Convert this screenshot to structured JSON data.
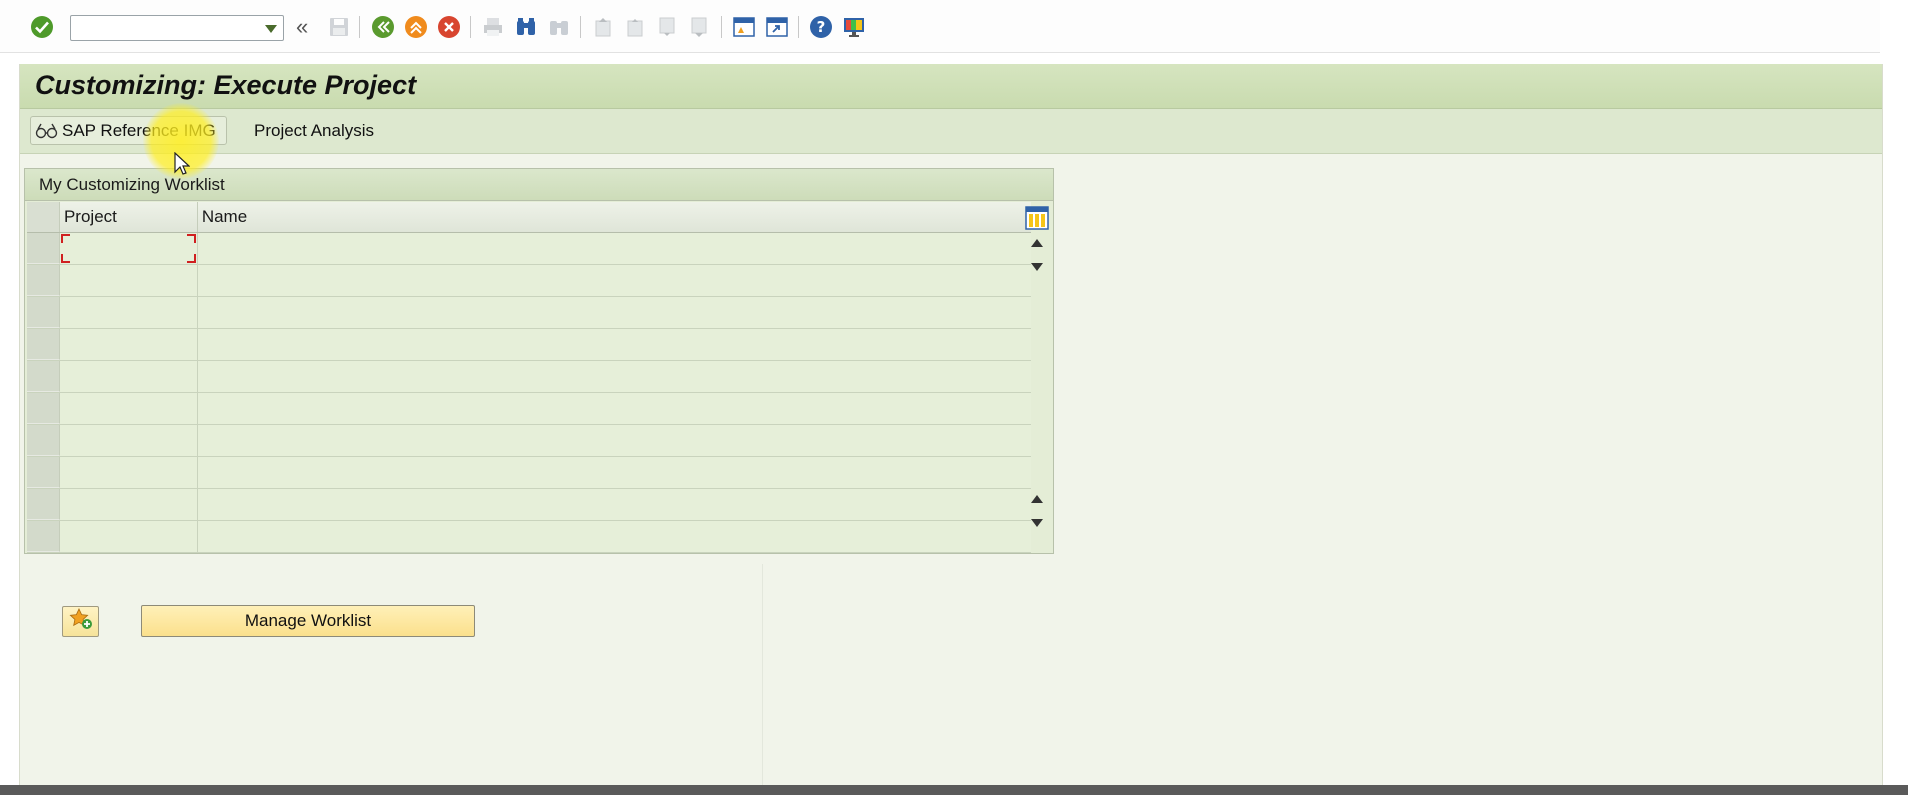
{
  "toolbar": {
    "command_field_value": "",
    "icons": [
      "enter-check-icon",
      "back-icon",
      "exit-icon",
      "cancel-icon",
      "save-icon",
      "print-icon",
      "find-icon",
      "find-next-icon",
      "first-page-icon",
      "previous-page-icon",
      "next-page-icon",
      "last-page-icon",
      "new-session-icon",
      "shortcut-icon",
      "help-icon",
      "customize-layout-icon"
    ]
  },
  "page": {
    "title": "Customizing: Execute Project"
  },
  "app_toolbar": {
    "sap_reference_img": "SAP Reference IMG",
    "project_analysis": "Project Analysis"
  },
  "worklist": {
    "heading": "My Customizing Worklist",
    "columns": [
      "Project",
      "Name"
    ],
    "rows": [
      {
        "project": "",
        "name": ""
      },
      {
        "project": "",
        "name": ""
      },
      {
        "project": "",
        "name": ""
      },
      {
        "project": "",
        "name": ""
      },
      {
        "project": "",
        "name": ""
      },
      {
        "project": "",
        "name": ""
      },
      {
        "project": "",
        "name": ""
      },
      {
        "project": "",
        "name": ""
      },
      {
        "project": "",
        "name": ""
      },
      {
        "project": "",
        "name": ""
      }
    ]
  },
  "buttons": {
    "manage_worklist": "Manage Worklist",
    "add_favorite_icon": "star-add-icon"
  },
  "colors": {
    "title_bar": "#d6e5c0",
    "background": "#f1f4ea",
    "button_yellow": "#fbe08c",
    "sap_green_icon": "#5a9a2e",
    "sap_orange_icon": "#f08b1d",
    "sap_red_icon": "#d8452f"
  }
}
